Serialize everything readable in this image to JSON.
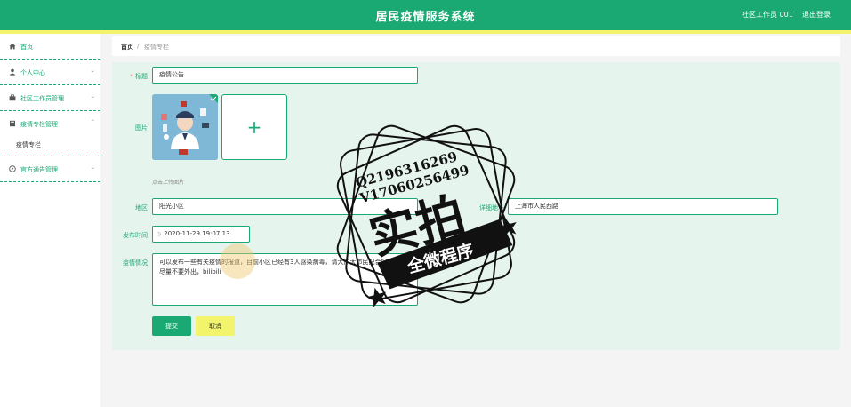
{
  "header": {
    "title": "居民疫情服务系统",
    "user": "社区工作员 001",
    "logout": "退出登录",
    "colors": {
      "primary": "#1aa873",
      "accent": "#f2f56b"
    }
  },
  "sidebar": {
    "items": [
      {
        "label": "首页",
        "icon": "home-icon"
      },
      {
        "label": "个人中心",
        "icon": "user-icon"
      },
      {
        "label": "社区工作员管理",
        "icon": "briefcase-icon"
      },
      {
        "label": "疫情专栏管理",
        "icon": "book-icon"
      },
      {
        "label": "疫情专栏",
        "sub": true
      },
      {
        "label": "官方通告管理",
        "icon": "compass-icon"
      }
    ]
  },
  "breadcrumb": {
    "home": "首页",
    "separator": "/",
    "current": "疫情专栏"
  },
  "form": {
    "title_label": "标题",
    "title_value": "疫情公告",
    "image_label": "图片",
    "image_hint": "点击上传图片",
    "region_label": "地区",
    "region_value": "阳光小区",
    "address_label": "详细地址",
    "address_value": "上海市人民西路",
    "time_label": "发布时间",
    "time_value": "2020-11-29 19:07:13",
    "desc_label": "疫情情况",
    "desc_value": "可以发布一些有关疫情的报道，目前小区已经有3人感染病毒，请大广大市民配合好工作，尽量不要外出，bilibili",
    "submit": "提交",
    "cancel": "取消"
  },
  "watermark": {
    "line1": "Q2196316269",
    "line2": "V17060256499",
    "main": "实拍",
    "banner": "全微程序"
  }
}
